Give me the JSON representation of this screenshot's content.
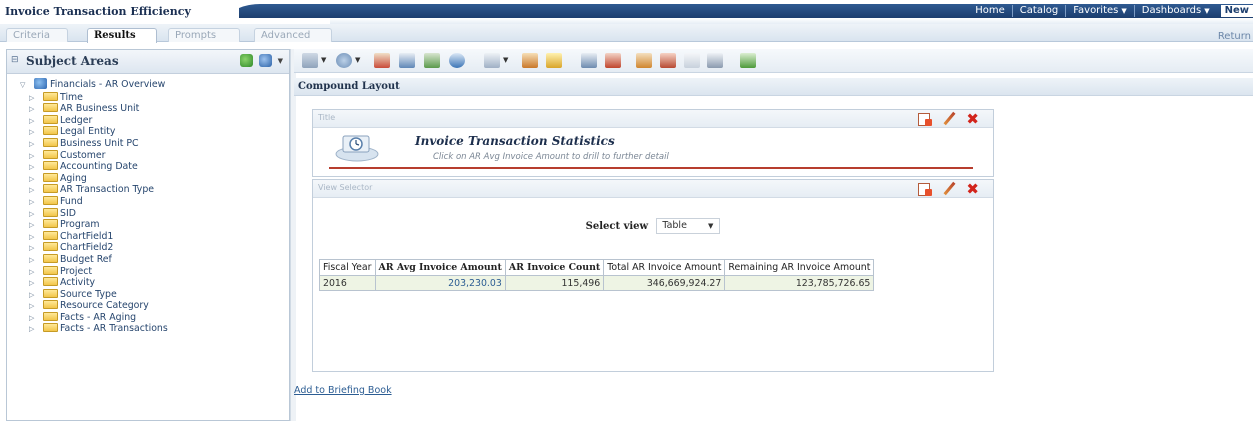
{
  "header": {
    "app_title": "Invoice Transaction Efficiency",
    "nav": [
      {
        "label": "Home",
        "dropdown": false
      },
      {
        "label": "Catalog",
        "dropdown": false
      },
      {
        "label": "Favorites",
        "dropdown": true
      },
      {
        "label": "Dashboards",
        "dropdown": true
      },
      {
        "label": "New",
        "dropdown": false
      }
    ]
  },
  "tabs": [
    {
      "label": "Criteria",
      "active": false
    },
    {
      "label": "Results",
      "active": true
    },
    {
      "label": "Prompts",
      "active": false
    },
    {
      "label": "Advanced",
      "active": false
    }
  ],
  "return_link": "Return",
  "subject_areas": {
    "title": "Subject Areas",
    "root": "Financials - AR Overview",
    "folders": [
      "Time",
      "AR Business Unit",
      "Ledger",
      "Legal Entity",
      "Business Unit PC",
      "Customer",
      "Accounting Date",
      "Aging",
      "AR Transaction Type",
      "Fund",
      "SID",
      "Program",
      "ChartField1",
      "ChartField2",
      "Budget Ref",
      "Project",
      "Activity",
      "Source Type",
      "Resource Category",
      "Facts - AR Aging",
      "Facts - AR Transactions"
    ]
  },
  "compound": {
    "heading": "Compound Layout",
    "title_view": {
      "label": "Title",
      "title": "Invoice Transaction Statistics",
      "subtitle": "Click on AR Avg Invoice Amount to drill to further detail"
    },
    "view_selector": {
      "label": "View Selector",
      "select_label": "Select view",
      "selected": "Table"
    },
    "table": {
      "columns": [
        "Fiscal Year",
        "AR Avg Invoice Amount",
        "AR Invoice Count",
        "Total AR Invoice Amount",
        "Remaining AR Invoice Amount"
      ],
      "bold_columns": [
        false,
        true,
        true,
        false,
        false
      ],
      "rows": [
        [
          "2016",
          "203,230.03",
          "115,496",
          "346,669,924.27",
          "123,785,726.65"
        ]
      ]
    },
    "briefing_link": "Add to Briefing Book"
  },
  "colors": {
    "header_band": "#1c3e6e",
    "link": "#2c5d93",
    "delete_red": "#d2241b",
    "data_cell_bg": "#eef4e4"
  }
}
